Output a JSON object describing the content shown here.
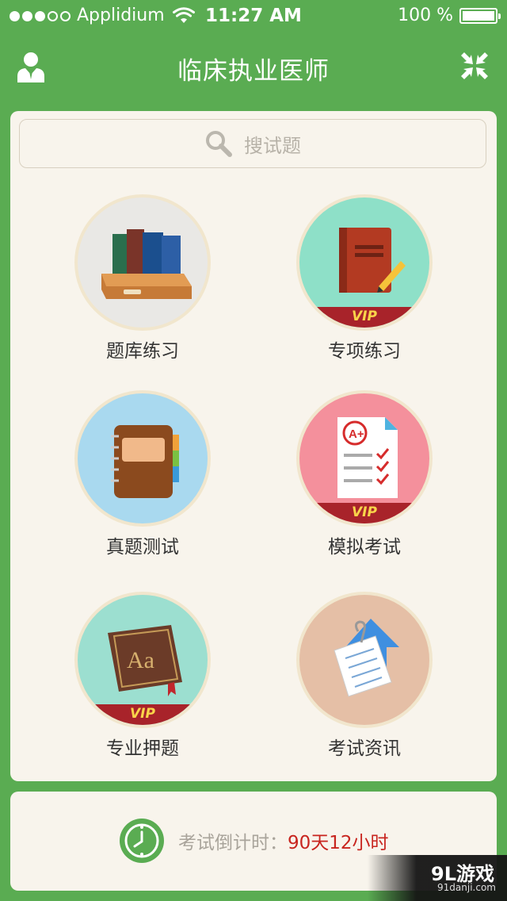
{
  "status_bar": {
    "carrier": "Applidium",
    "time": "11:27 AM",
    "battery_text": "100 %",
    "battery_level": 1.0,
    "signal_bars_filled": 3,
    "signal_bars_total": 5
  },
  "nav": {
    "title": "临床执业医师",
    "left_icon": "user-icon",
    "right_icon": "shrink-arrows-icon"
  },
  "search": {
    "placeholder": "搜试题",
    "icon": "search-icon"
  },
  "menu": [
    {
      "label": "题库练习",
      "vip": false,
      "icon": "books-drawer-icon",
      "bg": "#e9e8e5"
    },
    {
      "label": "专项练习",
      "vip": true,
      "vip_text": "VIP",
      "icon": "book-pencil-icon",
      "bg": "#8ee0c8"
    },
    {
      "label": "真题测试",
      "vip": false,
      "icon": "notebook-icon",
      "bg": "#a9d9ef"
    },
    {
      "label": "模拟考试",
      "vip": true,
      "vip_text": "VIP",
      "icon": "graded-paper-icon",
      "bg": "#f4909c"
    },
    {
      "label": "专业押题",
      "vip": true,
      "vip_text": "VIP",
      "icon": "dictionary-icon",
      "bg": "#9cdfd0"
    },
    {
      "label": "考试资讯",
      "vip": false,
      "icon": "document-arrow-icon",
      "bg": "#e5bfa6"
    }
  ],
  "countdown": {
    "label": "考试倒计时：",
    "value": "90天12小时",
    "icon": "clock-icon"
  },
  "watermark": {
    "logo": "9L游戏",
    "url": "91danji.com"
  },
  "colors": {
    "primary_green": "#5aac52",
    "card_bg": "#f8f4ec",
    "vip_red": "#a8232a",
    "vip_gold": "#f9d44a",
    "countdown_red": "#c8251f"
  }
}
